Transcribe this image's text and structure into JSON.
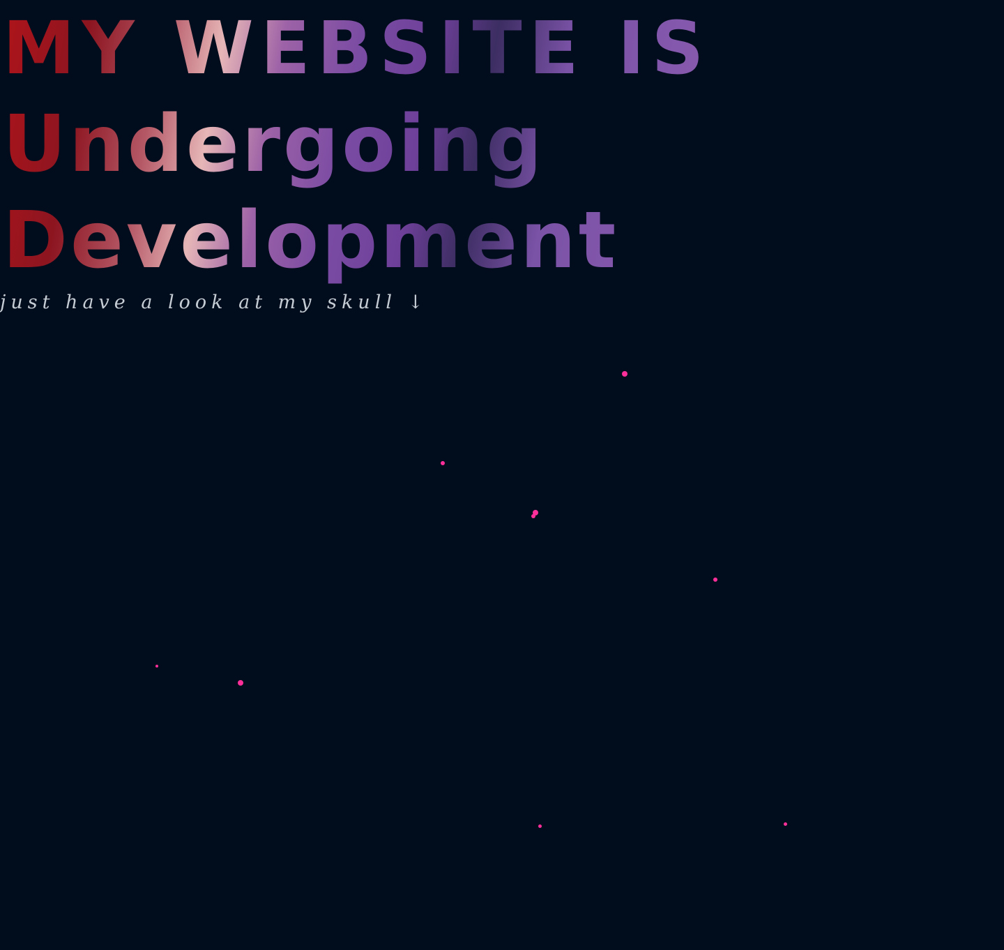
{
  "headline": {
    "line1": "MY WEBSITE IS",
    "line2": "Undergoing",
    "line3": "Development"
  },
  "tagline": "just have a look at my skull ↓",
  "colors": {
    "background": "#010d1d",
    "particle": "#ff2f9a",
    "tagline": "#c6ccd4",
    "headline_gradient": [
      "#b0141a",
      "#e6b6b7",
      "#7b4ca3",
      "#3c2d62",
      "#8b5cb0"
    ]
  }
}
